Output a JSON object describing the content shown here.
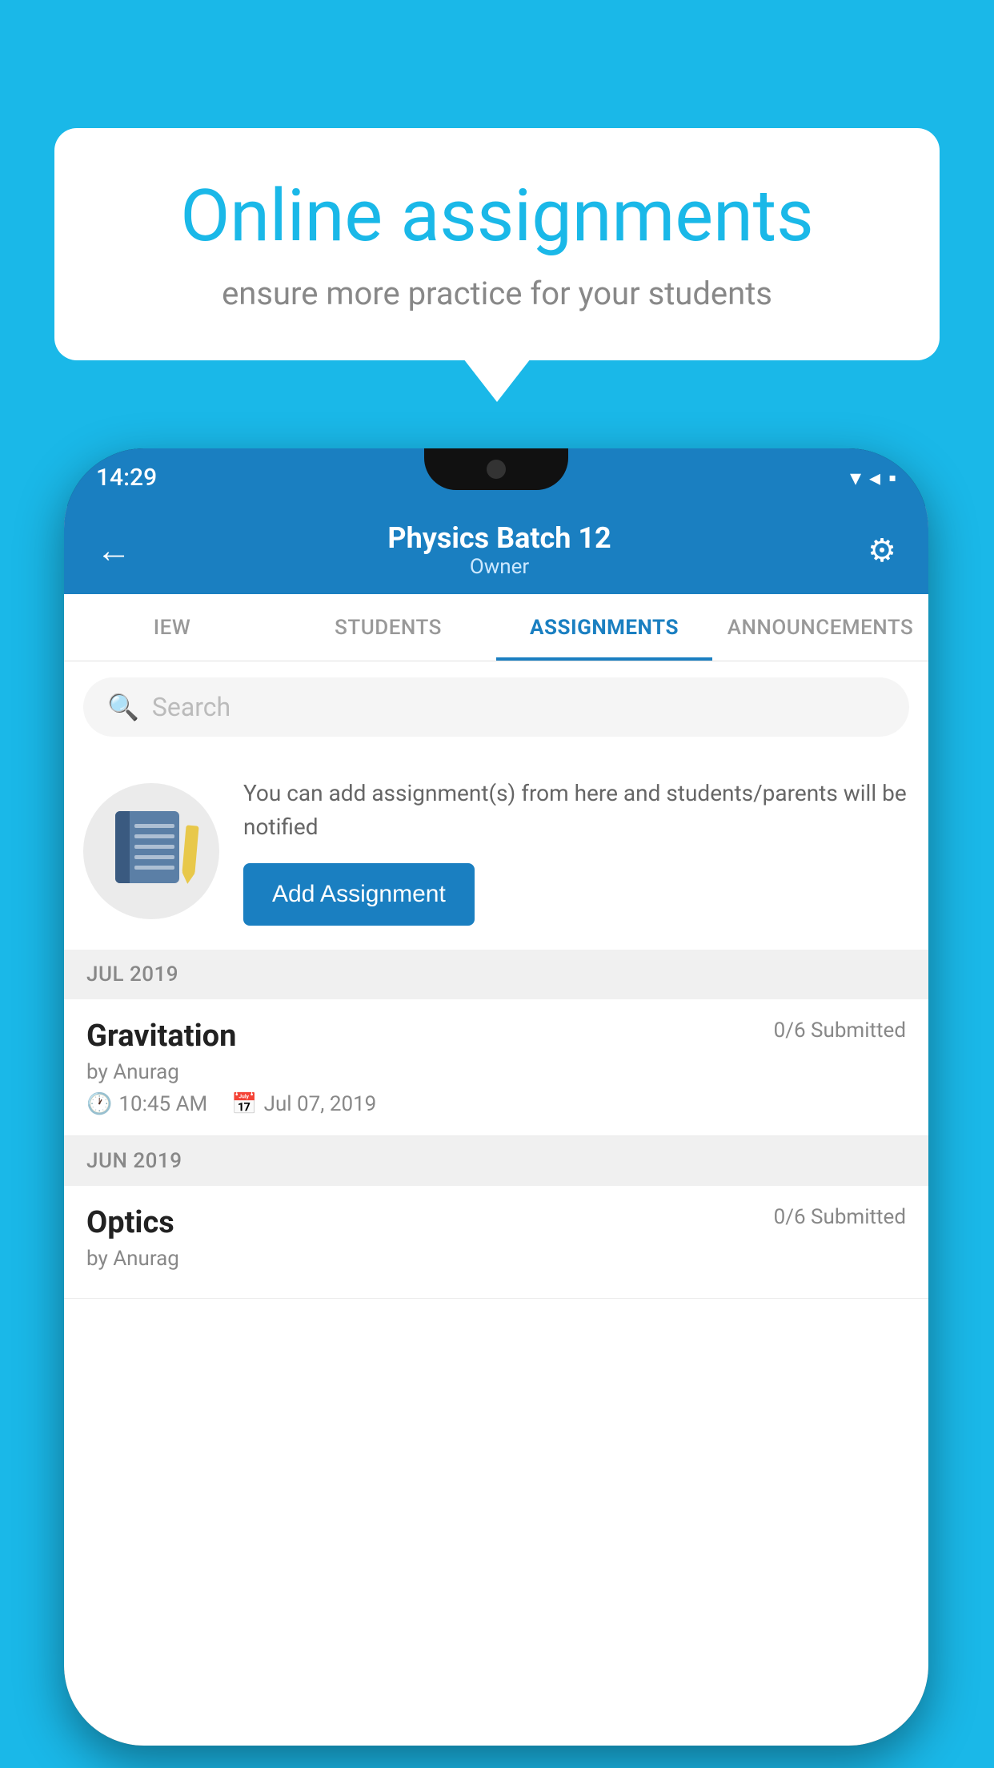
{
  "background_color": "#1ab8e8",
  "speech_bubble": {
    "title": "Online assignments",
    "subtitle": "ensure more practice for your students"
  },
  "phone": {
    "status_bar": {
      "time": "14:29",
      "icons": "▾◂▪"
    },
    "app_bar": {
      "title": "Physics Batch 12",
      "subtitle": "Owner",
      "back_label": "←",
      "settings_label": "⚙"
    },
    "tabs": [
      {
        "label": "IEW",
        "active": false
      },
      {
        "label": "STUDENTS",
        "active": false
      },
      {
        "label": "ASSIGNMENTS",
        "active": true
      },
      {
        "label": "ANNOUNCEMENTS",
        "active": false
      }
    ],
    "search": {
      "placeholder": "Search"
    },
    "info_card": {
      "description": "You can add assignment(s) from here and students/parents will be notified",
      "add_button_label": "Add Assignment"
    },
    "sections": [
      {
        "month_label": "JUL 2019",
        "assignments": [
          {
            "name": "Gravitation",
            "submitted": "0/6 Submitted",
            "by": "by Anurag",
            "time": "10:45 AM",
            "date": "Jul 07, 2019"
          }
        ]
      },
      {
        "month_label": "JUN 2019",
        "assignments": [
          {
            "name": "Optics",
            "submitted": "0/6 Submitted",
            "by": "by Anurag",
            "time": "",
            "date": ""
          }
        ]
      }
    ]
  }
}
